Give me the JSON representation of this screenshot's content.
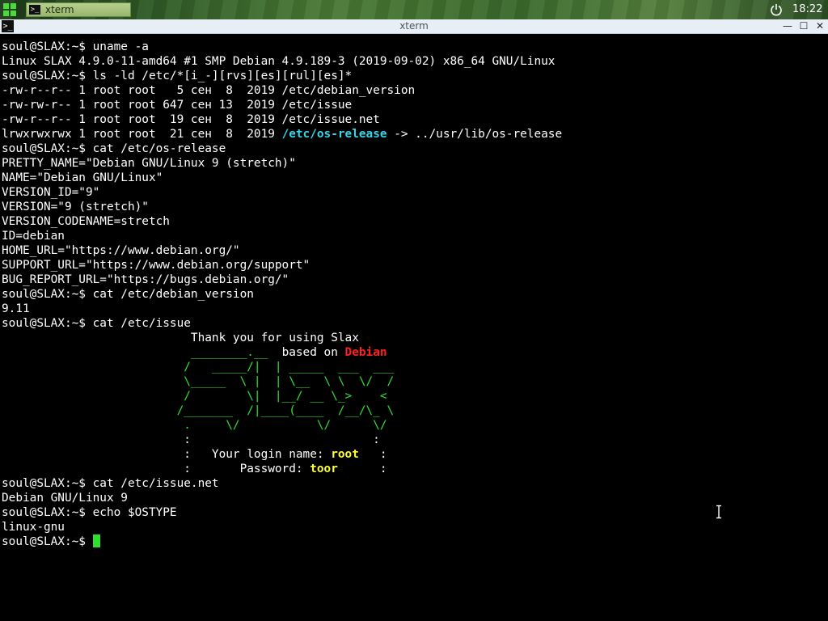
{
  "taskbar": {
    "task_label": "xterm",
    "task_icon_glyph": ">_",
    "clock": "18:22"
  },
  "window": {
    "title": "xterm",
    "icon_glyph": ">_",
    "minimize_glyph": "—",
    "maximize_glyph": "☐",
    "close_glyph": "✕"
  },
  "terminal": {
    "l1": "soul@SLAX:~$ uname -a",
    "l2": "Linux SLAX 4.9.0-11-amd64 #1 SMP Debian 4.9.189-3 (2019-09-02) x86_64 GNU/Linux",
    "l3": "soul@SLAX:~$ ls -ld /etc/*[i_-][rvs][es][rul][es]*",
    "l4": "-rw-r--r-- 1 root root   5 сен  8  2019 /etc/debian_version",
    "l5": "-rw-rw-r-- 1 root root 647 сен 13  2019 /etc/issue",
    "l6": "-rw-r--r-- 1 root root  19 сен  8  2019 /etc/issue.net",
    "l7a": "lrwxrwxrwx 1 root root  21 сен  8  2019 ",
    "l7b": "/etc/os-release",
    "l7c": " -> ../usr/lib/os-release",
    "l8": "soul@SLAX:~$ cat /etc/os-release",
    "l9": "PRETTY_NAME=\"Debian GNU/Linux 9 (stretch)\"",
    "l10": "NAME=\"Debian GNU/Linux\"",
    "l11": "VERSION_ID=\"9\"",
    "l12": "VERSION=\"9 (stretch)\"",
    "l13": "VERSION_CODENAME=stretch",
    "l14": "ID=debian",
    "l15": "HOME_URL=\"https://www.debian.org/\"",
    "l16": "SUPPORT_URL=\"https://www.debian.org/support\"",
    "l17": "BUG_REPORT_URL=\"https://bugs.debian.org/\"",
    "l18": "soul@SLAX:~$ cat /etc/debian_version",
    "l19": "9.11",
    "l20": "soul@SLAX:~$ cat /etc/issue",
    "l21": "                           Thank you for using Slax",
    "l22a": "                           ________.__  ",
    "l22b": "based on ",
    "l22c": "Debian",
    "l23": "                          /   _____/|  | _____  ___  ___",
    "l24": "                          \\_____  \\ |  | \\__  \\ \\  \\/  /",
    "l25": "                          /        \\|  |__/ __ \\_>    <",
    "l26": "                         /_______  /|____(____  /__/\\_ \\",
    "l27": "                          .     \\/           \\/      \\/",
    "l28": "                          :                          :",
    "l29a": "                          :   Your login name: ",
    "l29b": "root",
    "l29c": "   :",
    "l30a": "                          :       Password: ",
    "l30b": "toor",
    "l30c": "      :",
    "l31": "soul@SLAX:~$ cat /etc/issue.net",
    "l32": "Debian GNU/Linux 9",
    "l33": "soul@SLAX:~$ echo $OSTYPE",
    "l34": "linux-gnu",
    "l35": "soul@SLAX:~$ "
  },
  "colors": {
    "prompt_text": "#ffffff",
    "ascii_art": "#2fe02f",
    "debian_highlight": "#ff2020",
    "credentials": "#ffff33",
    "symlink": "#35d6ea",
    "cursor": "#2fe02f"
  }
}
